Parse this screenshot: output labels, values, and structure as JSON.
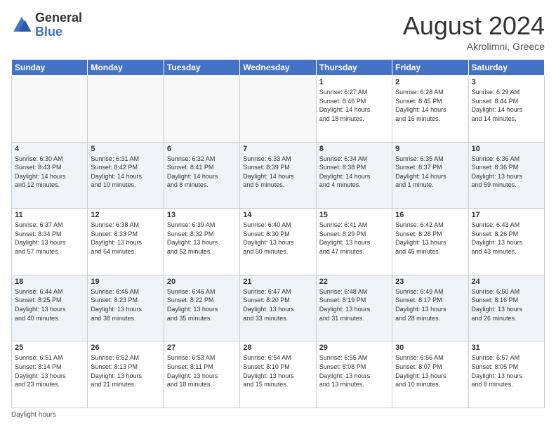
{
  "header": {
    "logo_general": "General",
    "logo_blue": "Blue",
    "month_title": "August 2024",
    "location": "Akrolimni, Greece"
  },
  "footer": {
    "note": "Daylight hours"
  },
  "days_of_week": [
    "Sunday",
    "Monday",
    "Tuesday",
    "Wednesday",
    "Thursday",
    "Friday",
    "Saturday"
  ],
  "weeks": [
    [
      {
        "day": "",
        "info": ""
      },
      {
        "day": "",
        "info": ""
      },
      {
        "day": "",
        "info": ""
      },
      {
        "day": "",
        "info": ""
      },
      {
        "day": "1",
        "info": "Sunrise: 6:27 AM\nSunset: 8:46 PM\nDaylight: 14 hours\nand 18 minutes."
      },
      {
        "day": "2",
        "info": "Sunrise: 6:28 AM\nSunset: 8:45 PM\nDaylight: 14 hours\nand 16 minutes."
      },
      {
        "day": "3",
        "info": "Sunrise: 6:29 AM\nSunset: 8:44 PM\nDaylight: 14 hours\nand 14 minutes."
      }
    ],
    [
      {
        "day": "4",
        "info": "Sunrise: 6:30 AM\nSunset: 8:43 PM\nDaylight: 14 hours\nand 12 minutes."
      },
      {
        "day": "5",
        "info": "Sunrise: 6:31 AM\nSunset: 8:42 PM\nDaylight: 14 hours\nand 10 minutes."
      },
      {
        "day": "6",
        "info": "Sunrise: 6:32 AM\nSunset: 8:41 PM\nDaylight: 14 hours\nand 8 minutes."
      },
      {
        "day": "7",
        "info": "Sunrise: 6:33 AM\nSunset: 8:39 PM\nDaylight: 14 hours\nand 6 minutes."
      },
      {
        "day": "8",
        "info": "Sunrise: 6:34 AM\nSunset: 8:38 PM\nDaylight: 14 hours\nand 4 minutes."
      },
      {
        "day": "9",
        "info": "Sunrise: 6:35 AM\nSunset: 8:37 PM\nDaylight: 14 hours\nand 1 minute."
      },
      {
        "day": "10",
        "info": "Sunrise: 6:36 AM\nSunset: 8:36 PM\nDaylight: 13 hours\nand 59 minutes."
      }
    ],
    [
      {
        "day": "11",
        "info": "Sunrise: 6:37 AM\nSunset: 8:34 PM\nDaylight: 13 hours\nand 57 minutes."
      },
      {
        "day": "12",
        "info": "Sunrise: 6:38 AM\nSunset: 8:33 PM\nDaylight: 13 hours\nand 54 minutes."
      },
      {
        "day": "13",
        "info": "Sunrise: 6:39 AM\nSunset: 8:32 PM\nDaylight: 13 hours\nand 52 minutes."
      },
      {
        "day": "14",
        "info": "Sunrise: 6:40 AM\nSunset: 8:30 PM\nDaylight: 13 hours\nand 50 minutes."
      },
      {
        "day": "15",
        "info": "Sunrise: 6:41 AM\nSunset: 8:29 PM\nDaylight: 13 hours\nand 47 minutes."
      },
      {
        "day": "16",
        "info": "Sunrise: 6:42 AM\nSunset: 8:28 PM\nDaylight: 13 hours\nand 45 minutes."
      },
      {
        "day": "17",
        "info": "Sunrise: 6:43 AM\nSunset: 8:26 PM\nDaylight: 13 hours\nand 43 minutes."
      }
    ],
    [
      {
        "day": "18",
        "info": "Sunrise: 6:44 AM\nSunset: 8:25 PM\nDaylight: 13 hours\nand 40 minutes."
      },
      {
        "day": "19",
        "info": "Sunrise: 6:45 AM\nSunset: 8:23 PM\nDaylight: 13 hours\nand 38 minutes."
      },
      {
        "day": "20",
        "info": "Sunrise: 6:46 AM\nSunset: 8:22 PM\nDaylight: 13 hours\nand 35 minutes."
      },
      {
        "day": "21",
        "info": "Sunrise: 6:47 AM\nSunset: 8:20 PM\nDaylight: 13 hours\nand 33 minutes."
      },
      {
        "day": "22",
        "info": "Sunrise: 6:48 AM\nSunset: 8:19 PM\nDaylight: 13 hours\nand 31 minutes."
      },
      {
        "day": "23",
        "info": "Sunrise: 6:49 AM\nSunset: 8:17 PM\nDaylight: 13 hours\nand 28 minutes."
      },
      {
        "day": "24",
        "info": "Sunrise: 6:50 AM\nSunset: 8:16 PM\nDaylight: 13 hours\nand 26 minutes."
      }
    ],
    [
      {
        "day": "25",
        "info": "Sunrise: 6:51 AM\nSunset: 8:14 PM\nDaylight: 13 hours\nand 23 minutes."
      },
      {
        "day": "26",
        "info": "Sunrise: 6:52 AM\nSunset: 8:13 PM\nDaylight: 13 hours\nand 21 minutes."
      },
      {
        "day": "27",
        "info": "Sunrise: 6:53 AM\nSunset: 8:11 PM\nDaylight: 13 hours\nand 18 minutes."
      },
      {
        "day": "28",
        "info": "Sunrise: 6:54 AM\nSunset: 8:10 PM\nDaylight: 13 hours\nand 15 minutes."
      },
      {
        "day": "29",
        "info": "Sunrise: 6:55 AM\nSunset: 8:08 PM\nDaylight: 13 hours\nand 13 minutes."
      },
      {
        "day": "30",
        "info": "Sunrise: 6:56 AM\nSunset: 8:07 PM\nDaylight: 13 hours\nand 10 minutes."
      },
      {
        "day": "31",
        "info": "Sunrise: 6:57 AM\nSunset: 8:05 PM\nDaylight: 13 hours\nand 8 minutes."
      }
    ]
  ]
}
